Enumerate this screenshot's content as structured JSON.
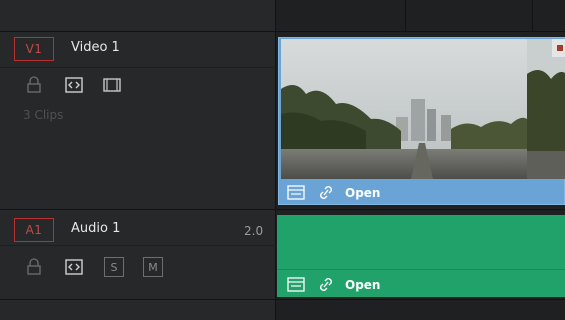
{
  "video_track": {
    "badge": "V1",
    "name": "Video 1",
    "clip_count_label": "3 Clips",
    "controls": [
      "lock-icon",
      "auto-select-icon",
      "film-icon"
    ],
    "clip": {
      "label": "Open",
      "color": "#6aa4d6"
    }
  },
  "audio_track": {
    "badge": "A1",
    "name": "Audio 1",
    "channels": "2.0",
    "controls": [
      "lock-icon",
      "auto-select-icon",
      "solo-button",
      "mute-button"
    ],
    "solo_label": "S",
    "mute_label": "M",
    "clip": {
      "label": "Open",
      "color": "#21a26b"
    }
  },
  "colors": {
    "badge_border": "#b8312f",
    "panel": "#27282a",
    "lane": "#1f2022"
  }
}
